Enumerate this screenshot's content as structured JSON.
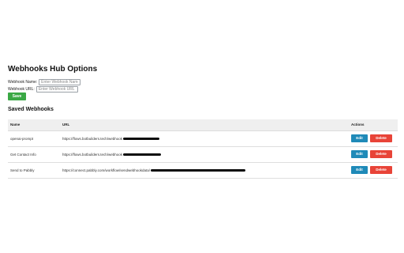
{
  "page": {
    "title": "Webhooks Hub Options"
  },
  "form": {
    "name_label": "Webhook Name:",
    "name_placeholder": "Enter Webhook Name",
    "url_label": "Webhook URL:",
    "url_placeholder": "Enter Webhook URL",
    "save_label": "Save"
  },
  "saved": {
    "heading": "Saved Webhooks",
    "columns": {
      "name": "Name",
      "url": "URL",
      "actions": "Actions"
    },
    "rows": [
      {
        "name": "openai-prompt",
        "url": "https://flows.botbuilders.tech/webhook",
        "edit_label": "Edit",
        "delete_label": "Delete"
      },
      {
        "name": "Get Contact Info",
        "url": "https://flows.botbuilders.tech/webhook",
        "edit_label": "Edit",
        "delete_label": "Delete"
      },
      {
        "name": "Send to Pabbly",
        "url": "https://connect.pabbly.com/workflow/sendwebhookdata/",
        "edit_label": "Edit",
        "delete_label": "Delete"
      }
    ]
  },
  "colors": {
    "save_button": "#3aa845",
    "edit_button": "#1f8ab8",
    "delete_button": "#e84438",
    "header_row": "#efefef"
  }
}
